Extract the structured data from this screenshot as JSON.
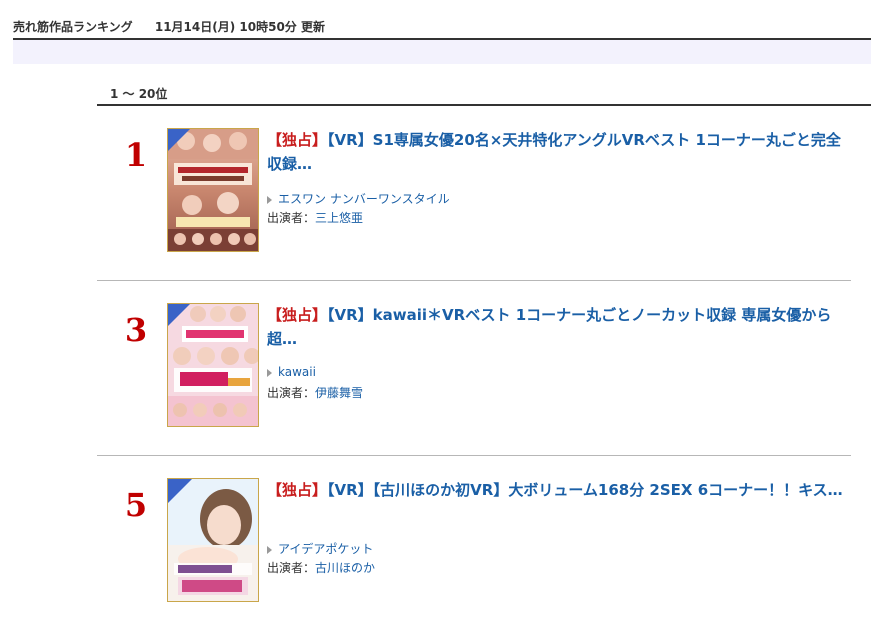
{
  "header": {
    "title": "売れ筋作品ランキング",
    "updated": "11月14日(月) 10時50分 更新"
  },
  "range": {
    "label": "1 ～ 20位"
  },
  "items": [
    {
      "rank": "1",
      "exclusive": "【独占】",
      "title": "【VR】S1専属女優20名×天井特化アングルVRベスト 1コーナー丸ごと完全収録…",
      "maker": "エスワン ナンバーワンスタイル",
      "cast_label": "出演者：",
      "cast": "三上悠亜"
    },
    {
      "rank": "3",
      "exclusive": "【独占】",
      "title": "【VR】kawaii＊VRベスト 1コーナー丸ごとノーカット収録 専属女優から超…",
      "maker": "kawaii",
      "cast_label": "出演者：",
      "cast": "伊藤舞雪"
    },
    {
      "rank": "5",
      "exclusive": "【独占】",
      "title": "【VR】【古川ほのか初VR】大ボリューム168分 2SEX 6コーナー！！キス…",
      "maker": "アイデアポケット",
      "cast_label": "出演者：",
      "cast": "古川ほのか"
    }
  ],
  "colors": {
    "rank": "#c00000",
    "link": "#1a5fa6",
    "exclusive": "#c81e1e",
    "band": "#f3f2fd"
  }
}
